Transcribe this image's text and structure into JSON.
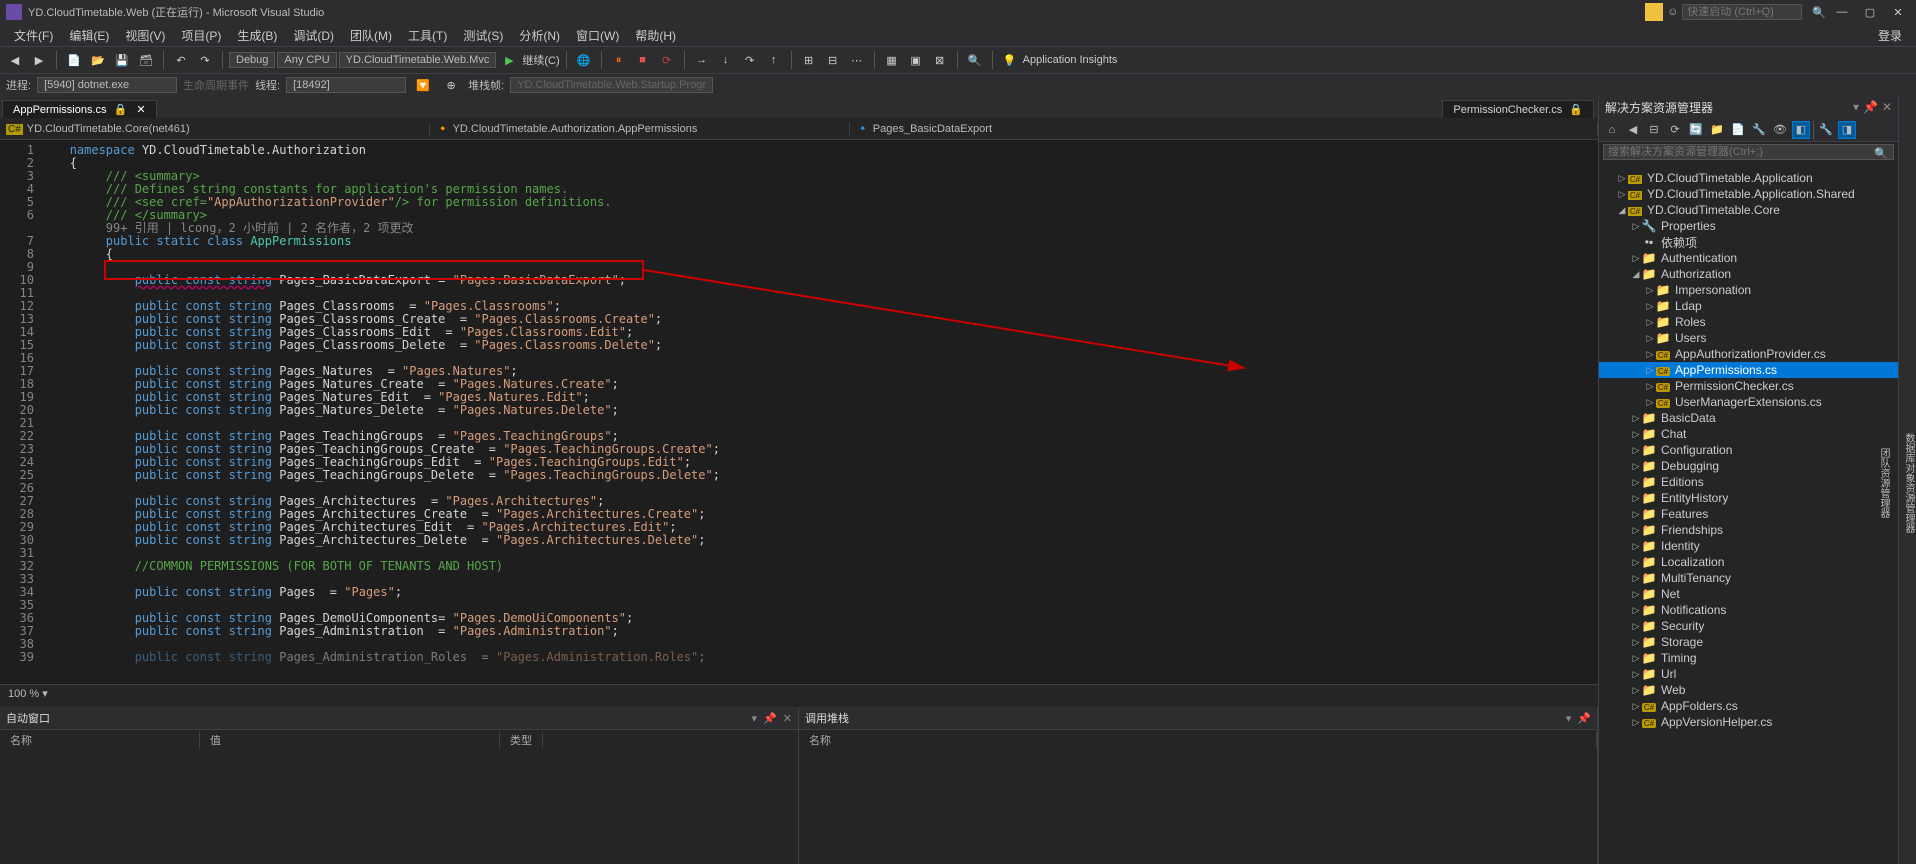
{
  "titlebar": {
    "title": "YD.CloudTimetable.Web (正在运行) - Microsoft Visual Studio",
    "quick_launch": "快速启动 (Ctrl+Q)"
  },
  "menu": {
    "items": [
      "文件(F)",
      "编辑(E)",
      "视图(V)",
      "项目(P)",
      "生成(B)",
      "调试(D)",
      "团队(M)",
      "工具(T)",
      "测试(S)",
      "分析(N)",
      "窗口(W)",
      "帮助(H)"
    ],
    "login": "登录"
  },
  "toolbar": {
    "combo_config": "Debug",
    "combo_platform": "Any CPU",
    "combo_project": "YD.CloudTimetable.Web.Mvc",
    "continue": "继续(C)",
    "insights": "Application Insights"
  },
  "processbar": {
    "label_process": "进程:",
    "process": "[5940] dotnet.exe",
    "lifecycle": "生命周期事件",
    "label_thread": "线程:",
    "thread": "[18492]",
    "label_stack": "堆栈帧:",
    "stackframe": "YD.CloudTimetable.Web.Startup.Progr"
  },
  "tabs": {
    "active": "AppPermissions.cs",
    "right": "PermissionChecker.cs"
  },
  "context": {
    "project": "YD.CloudTimetable.Core(net461)",
    "class": "YD.CloudTimetable.Authorization.AppPermissions",
    "field": "Pages_BasicDataExport"
  },
  "codelens": "99+ 引用 | lcong，2 小时前 | 2 名作者，2 项更改",
  "code_lines": [
    {
      "n": 1,
      "t": "namespace",
      "txt": "YD.CloudTimetable.Authorization"
    },
    {
      "n": 2,
      "t": "brace",
      "txt": "{"
    },
    {
      "n": 3,
      "t": "com",
      "txt": "/// <summary>"
    },
    {
      "n": 4,
      "t": "com",
      "txt": "/// Defines string constants for application's permission names."
    },
    {
      "n": 5,
      "t": "com-see",
      "pre": "/// <see cref=",
      "name": "AppAuthorizationProvider",
      "post": "/> for permission definitions."
    },
    {
      "n": 6,
      "t": "com",
      "txt": "/// </summary>"
    },
    {
      "n": 0,
      "t": "codelens"
    },
    {
      "n": 7,
      "t": "class",
      "name": "AppPermissions"
    },
    {
      "n": 8,
      "t": "brace2",
      "txt": "{"
    },
    {
      "n": 9,
      "t": "blank"
    },
    {
      "n": 10,
      "t": "const",
      "name": "Pages_BasicDataExport",
      "val": "Pages.BasicDataExport",
      "hl": true,
      "under": true
    },
    {
      "n": 11,
      "t": "blank"
    },
    {
      "n": 12,
      "t": "const",
      "name": "Pages_Classrooms",
      "val": "Pages.Classrooms"
    },
    {
      "n": 13,
      "t": "const",
      "name": "Pages_Classrooms_Create",
      "val": "Pages.Classrooms.Create"
    },
    {
      "n": 14,
      "t": "const",
      "name": "Pages_Classrooms_Edit",
      "val": "Pages.Classrooms.Edit"
    },
    {
      "n": 15,
      "t": "const",
      "name": "Pages_Classrooms_Delete",
      "val": "Pages.Classrooms.Delete"
    },
    {
      "n": 16,
      "t": "blank"
    },
    {
      "n": 17,
      "t": "const",
      "name": "Pages_Natures",
      "val": "Pages.Natures"
    },
    {
      "n": 18,
      "t": "const",
      "name": "Pages_Natures_Create",
      "val": "Pages.Natures.Create"
    },
    {
      "n": 19,
      "t": "const",
      "name": "Pages_Natures_Edit",
      "val": "Pages.Natures.Edit"
    },
    {
      "n": 20,
      "t": "const",
      "name": "Pages_Natures_Delete",
      "val": "Pages.Natures.Delete"
    },
    {
      "n": 21,
      "t": "blank"
    },
    {
      "n": 22,
      "t": "const",
      "name": "Pages_TeachingGroups",
      "val": "Pages.TeachingGroups"
    },
    {
      "n": 23,
      "t": "const",
      "name": "Pages_TeachingGroups_Create",
      "val": "Pages.TeachingGroups.Create"
    },
    {
      "n": 24,
      "t": "const",
      "name": "Pages_TeachingGroups_Edit",
      "val": "Pages.TeachingGroups.Edit"
    },
    {
      "n": 25,
      "t": "const",
      "name": "Pages_TeachingGroups_Delete",
      "val": "Pages.TeachingGroups.Delete"
    },
    {
      "n": 26,
      "t": "blank"
    },
    {
      "n": 27,
      "t": "const",
      "name": "Pages_Architectures",
      "val": "Pages.Architectures"
    },
    {
      "n": 28,
      "t": "const",
      "name": "Pages_Architectures_Create",
      "val": "Pages.Architectures.Create"
    },
    {
      "n": 29,
      "t": "const",
      "name": "Pages_Architectures_Edit",
      "val": "Pages.Architectures.Edit"
    },
    {
      "n": 30,
      "t": "const",
      "name": "Pages_Architectures_Delete",
      "val": "Pages.Architectures.Delete"
    },
    {
      "n": 31,
      "t": "blank"
    },
    {
      "n": 32,
      "t": "com2",
      "txt": "//COMMON PERMISSIONS (FOR BOTH OF TENANTS AND HOST)"
    },
    {
      "n": 33,
      "t": "blank"
    },
    {
      "n": 34,
      "t": "const",
      "name": "Pages",
      "val": "Pages"
    },
    {
      "n": 35,
      "t": "blank"
    },
    {
      "n": 36,
      "t": "const-eq",
      "name": "Pages_DemoUiComponents",
      "val": "Pages.DemoUiComponents"
    },
    {
      "n": 37,
      "t": "const",
      "name": "Pages_Administration",
      "val": "Pages.Administration"
    },
    {
      "n": 38,
      "t": "blank"
    },
    {
      "n": 39,
      "t": "const-dim",
      "name": "Pages_Administration_Roles",
      "val": "Pages.Administration.Roles"
    }
  ],
  "bottom": {
    "zoom": "100 %",
    "autos_title": "自动窗口",
    "callstack_title": "调用堆栈",
    "col_name": "名称",
    "col_value": "值",
    "col_type": "类型"
  },
  "sidebar": {
    "title": "解决方案资源管理器",
    "search_placeholder": "搜索解决方案资源管理器(Ctrl+;)",
    "tree": [
      {
        "depth": 0,
        "exp": "▷",
        "icon": "csproj",
        "label": "YD.CloudTimetable.Application"
      },
      {
        "depth": 0,
        "exp": "▷",
        "icon": "csproj",
        "label": "YD.CloudTimetable.Application.Shared"
      },
      {
        "depth": 0,
        "exp": "◢",
        "icon": "csproj",
        "label": "YD.CloudTimetable.Core"
      },
      {
        "depth": 1,
        "exp": "▷",
        "icon": "wrench",
        "label": "Properties"
      },
      {
        "depth": 1,
        "exp": "",
        "icon": "deps",
        "label": "依赖项"
      },
      {
        "depth": 1,
        "exp": "▷",
        "icon": "folder",
        "label": "Authentication"
      },
      {
        "depth": 1,
        "exp": "◢",
        "icon": "folder",
        "label": "Authorization"
      },
      {
        "depth": 2,
        "exp": "▷",
        "icon": "folder",
        "label": "Impersonation"
      },
      {
        "depth": 2,
        "exp": "▷",
        "icon": "folder",
        "label": "Ldap"
      },
      {
        "depth": 2,
        "exp": "▷",
        "icon": "folder",
        "label": "Roles"
      },
      {
        "depth": 2,
        "exp": "▷",
        "icon": "folder",
        "label": "Users"
      },
      {
        "depth": 2,
        "exp": "▷",
        "icon": "cs",
        "label": "AppAuthorizationProvider.cs"
      },
      {
        "depth": 2,
        "exp": "▷",
        "icon": "cs",
        "label": "AppPermissions.cs",
        "selected": true
      },
      {
        "depth": 2,
        "exp": "▷",
        "icon": "cs",
        "label": "PermissionChecker.cs"
      },
      {
        "depth": 2,
        "exp": "▷",
        "icon": "cs",
        "label": "UserManagerExtensions.cs"
      },
      {
        "depth": 1,
        "exp": "▷",
        "icon": "folder",
        "label": "BasicData"
      },
      {
        "depth": 1,
        "exp": "▷",
        "icon": "folder",
        "label": "Chat"
      },
      {
        "depth": 1,
        "exp": "▷",
        "icon": "folder",
        "label": "Configuration"
      },
      {
        "depth": 1,
        "exp": "▷",
        "icon": "folder",
        "label": "Debugging"
      },
      {
        "depth": 1,
        "exp": "▷",
        "icon": "folder",
        "label": "Editions"
      },
      {
        "depth": 1,
        "exp": "▷",
        "icon": "folder",
        "label": "EntityHistory"
      },
      {
        "depth": 1,
        "exp": "▷",
        "icon": "folder",
        "label": "Features"
      },
      {
        "depth": 1,
        "exp": "▷",
        "icon": "folder",
        "label": "Friendships"
      },
      {
        "depth": 1,
        "exp": "▷",
        "icon": "folder",
        "label": "Identity"
      },
      {
        "depth": 1,
        "exp": "▷",
        "icon": "folder",
        "label": "Localization"
      },
      {
        "depth": 1,
        "exp": "▷",
        "icon": "folder",
        "label": "MultiTenancy"
      },
      {
        "depth": 1,
        "exp": "▷",
        "icon": "folder",
        "label": "Net"
      },
      {
        "depth": 1,
        "exp": "▷",
        "icon": "folder",
        "label": "Notifications"
      },
      {
        "depth": 1,
        "exp": "▷",
        "icon": "folder",
        "label": "Security"
      },
      {
        "depth": 1,
        "exp": "▷",
        "icon": "folder",
        "label": "Storage"
      },
      {
        "depth": 1,
        "exp": "▷",
        "icon": "folder",
        "label": "Timing"
      },
      {
        "depth": 1,
        "exp": "▷",
        "icon": "folder",
        "label": "Url"
      },
      {
        "depth": 1,
        "exp": "▷",
        "icon": "folder",
        "label": "Web"
      },
      {
        "depth": 1,
        "exp": "▷",
        "icon": "cs",
        "label": "AppFolders.cs"
      },
      {
        "depth": 1,
        "exp": "▷",
        "icon": "cs",
        "label": "AppVersionHelper.cs"
      }
    ]
  },
  "right_rail": [
    "数据库对象资源管理器",
    "团队资源管理器"
  ]
}
